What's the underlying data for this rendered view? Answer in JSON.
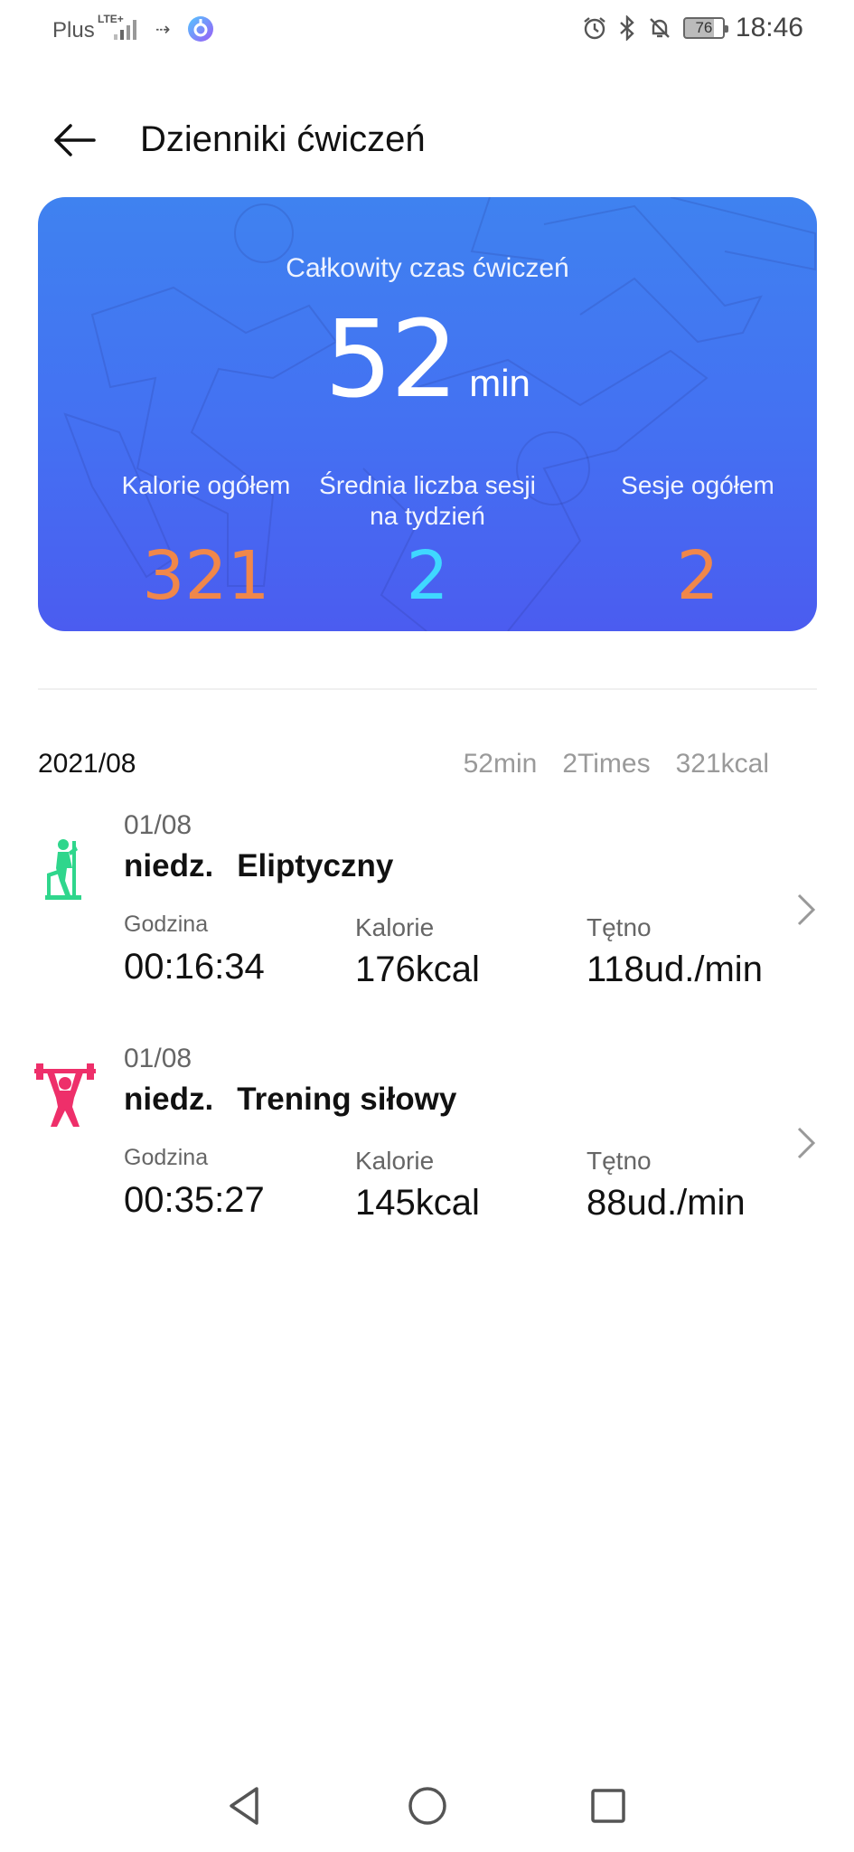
{
  "status_bar": {
    "carrier": "Plus",
    "network": "LTE+",
    "battery": "76",
    "time": "18:46"
  },
  "header": {
    "title": "Dzienniki ćwiczeń"
  },
  "summary": {
    "total_label": "Całkowity czas ćwiczeń",
    "total_value": "52",
    "total_unit": "min",
    "stats": [
      {
        "label": "Kalorie ogółem",
        "value": "321",
        "color": "#f0874a"
      },
      {
        "label": "Średnia liczba sesji na tydzień",
        "value": "2",
        "color": "#3fd8ff"
      },
      {
        "label": "Sesje ogółem",
        "value": "2",
        "color": "#f0874a"
      }
    ]
  },
  "month": {
    "label": "2021/08",
    "duration": "52min",
    "times": "2Times",
    "calories": "321kcal"
  },
  "entries": [
    {
      "date": "01/08",
      "day": "niedz.",
      "type": "Eliptyczny",
      "icon": "elliptical-icon",
      "icon_color": "#2fd68c",
      "time_label": "Godzina",
      "time_value": "00:16:34",
      "cal_label": "Kalorie",
      "cal_value": "176kcal",
      "hr_label": "Tętno",
      "hr_value": "118ud./min"
    },
    {
      "date": "01/08",
      "day": "niedz.",
      "type": "Trening siłowy",
      "icon": "weightlifting-icon",
      "icon_color": "#ee2f6a",
      "time_label": "Godzina",
      "time_value": "00:35:27",
      "cal_label": "Kalorie",
      "cal_value": "145kcal",
      "hr_label": "Tętno",
      "hr_value": "88ud./min"
    }
  ]
}
